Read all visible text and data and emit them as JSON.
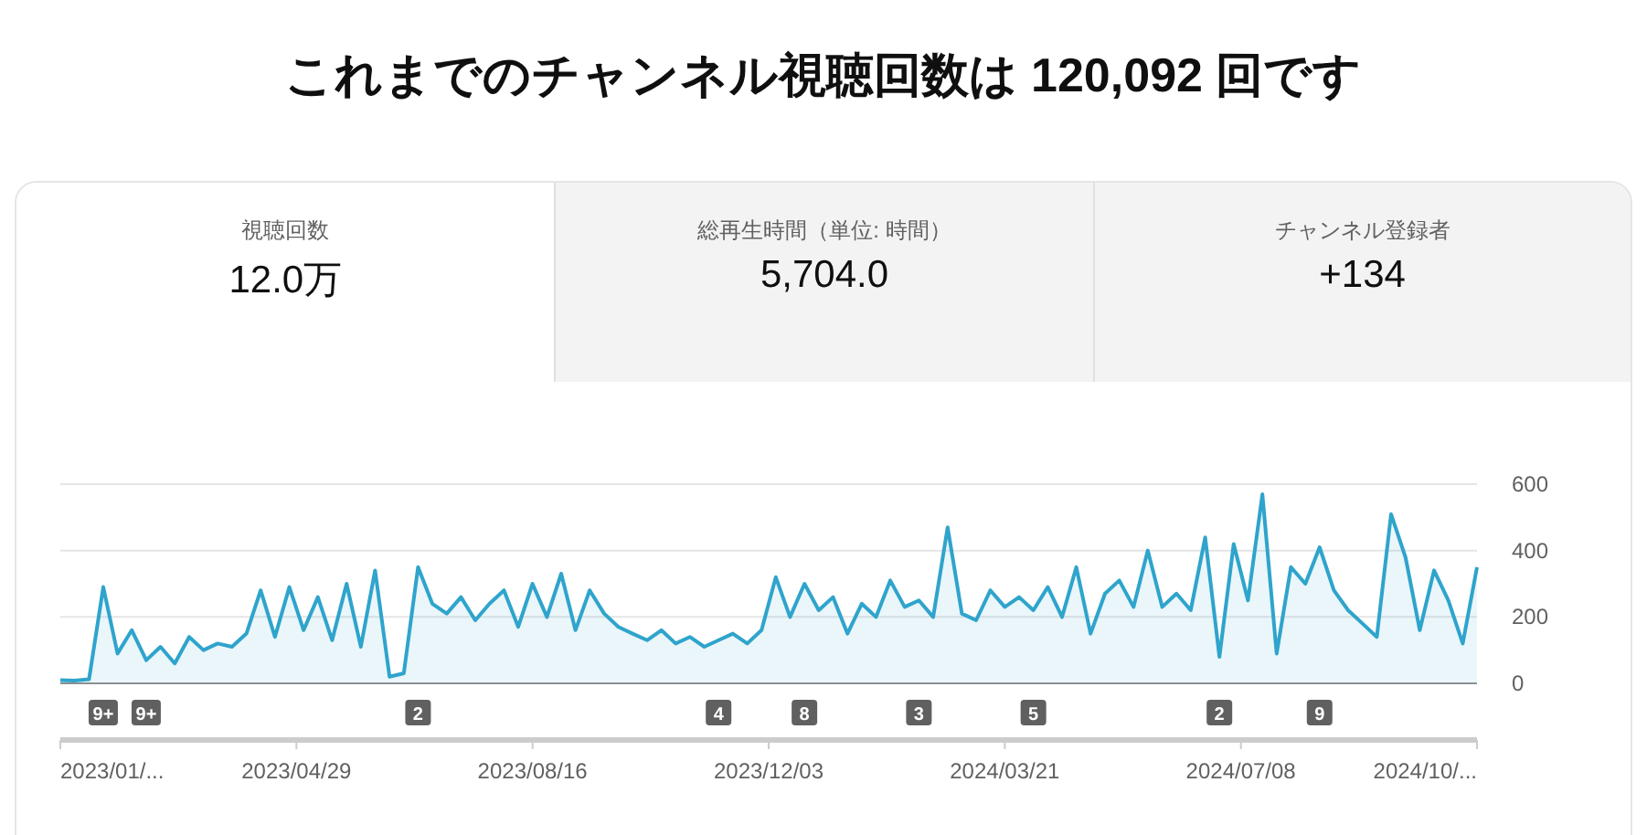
{
  "title": "これまでのチャンネル視聴回数は 120,092 回です",
  "tabs": [
    {
      "label": "視聴回数",
      "value": "12.0万",
      "selected": true
    },
    {
      "label": "総再生時間（単位: 時間）",
      "value": "5,704.0",
      "selected": false
    },
    {
      "label": "チャンネル登録者",
      "value": "+134",
      "selected": false
    }
  ],
  "chart_data": {
    "type": "area",
    "ylim": [
      0,
      600
    ],
    "yticks": [
      0,
      200,
      400,
      600
    ],
    "series": [
      {
        "color": "#2fa4cc",
        "values": [
          10,
          8,
          12,
          290,
          90,
          160,
          70,
          110,
          60,
          140,
          100,
          120,
          110,
          150,
          280,
          140,
          290,
          160,
          260,
          130,
          300,
          110,
          340,
          20,
          30,
          350,
          240,
          210,
          260,
          190,
          240,
          280,
          170,
          300,
          200,
          330,
          160,
          280,
          210,
          170,
          150,
          130,
          160,
          120,
          140,
          110,
          130,
          150,
          120,
          160,
          320,
          200,
          300,
          220,
          260,
          150,
          240,
          200,
          310,
          230,
          250,
          200,
          470,
          210,
          190,
          280,
          230,
          260,
          220,
          290,
          200,
          350,
          150,
          270,
          310,
          230,
          400,
          230,
          270,
          220,
          440,
          80,
          420,
          250,
          570,
          90,
          350,
          300,
          410,
          280,
          220,
          180,
          140,
          510,
          380,
          160,
          340,
          250,
          120,
          350
        ]
      }
    ]
  },
  "markers": [
    {
      "text": "9+"
    },
    {
      "text": "9+"
    },
    {
      "text": "2"
    },
    {
      "text": "4"
    },
    {
      "text": "8"
    },
    {
      "text": "3"
    },
    {
      "text": "5"
    },
    {
      "text": "2"
    },
    {
      "text": "9"
    }
  ],
  "x_axis_labels": [
    "2023/01/...",
    "2023/04/29",
    "2023/08/16",
    "2023/12/03",
    "2024/03/21",
    "2024/07/08",
    "2024/10/..."
  ]
}
